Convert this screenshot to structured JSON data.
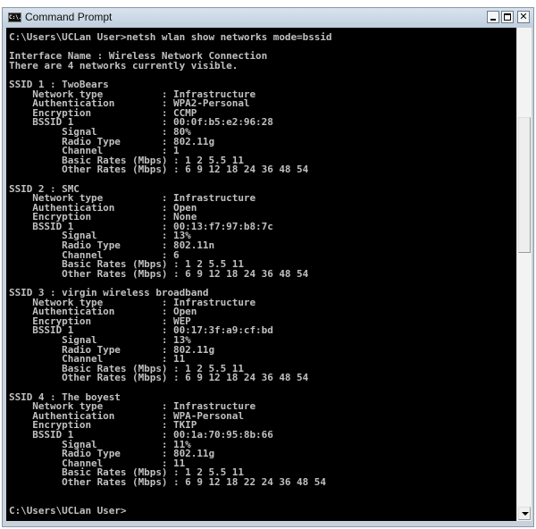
{
  "window": {
    "title": "Command Prompt",
    "icon": "cmd-icon",
    "icon_text": "C:\\.",
    "buttons": {
      "minimize": "minimize-icon",
      "maximize": "maximize-icon",
      "close": "✕"
    }
  },
  "console": {
    "command_prompt": "C:\\Users\\UCLan User>",
    "command": "netsh wlan show networks mode=bssid",
    "interface_line": "Interface Name : Wireless Network Connection",
    "summary_line": "There are 4 networks currently visible.",
    "networks": [
      {
        "ssid_index": "1",
        "ssid": "TwoBears",
        "network_type": "Infrastructure",
        "authentication": "WPA2-Personal",
        "encryption": "CCMP",
        "bssid_index": "1",
        "bssid": "00:0f:b5:e2:96:28",
        "signal": "80%",
        "radio_type": "802.11g",
        "channel": "1",
        "basic_rates": "1 2 5.5 11",
        "other_rates": "6 9 12 18 24 36 48 54"
      },
      {
        "ssid_index": "2",
        "ssid": "SMC",
        "network_type": "Infrastructure",
        "authentication": "Open",
        "encryption": "None",
        "bssid_index": "1",
        "bssid": "00:13:f7:97:b8:7c",
        "signal": "13%",
        "radio_type": "802.11n",
        "channel": "6",
        "basic_rates": "1 2 5.5 11",
        "other_rates": "6 9 12 18 24 36 48 54"
      },
      {
        "ssid_index": "3",
        "ssid": "virgin wireless broadband",
        "network_type": "Infrastructure",
        "authentication": "Open",
        "encryption": "WEP",
        "bssid_index": "1",
        "bssid": "00:17:3f:a9:cf:bd",
        "signal": "13%",
        "radio_type": "802.11g",
        "channel": "11",
        "basic_rates": "1 2 5.5 11",
        "other_rates": "6 9 12 18 24 36 48 54"
      },
      {
        "ssid_index": "4",
        "ssid": "The boyest",
        "network_type": "Infrastructure",
        "authentication": "WPA-Personal",
        "encryption": "TKIP",
        "bssid_index": "1",
        "bssid": "00:1a:70:95:8b:66",
        "signal": "11%",
        "radio_type": "802.11g",
        "channel": "11",
        "basic_rates": "1 2 5.5 11",
        "other_rates": "6 9 12 18 22 24 36 48 54"
      }
    ],
    "labels": {
      "network_type": "Network type",
      "authentication": "Authentication",
      "encryption": "Encryption",
      "bssid": "BSSID",
      "signal": "Signal",
      "radio_type": "Radio Type",
      "channel": "Channel",
      "basic_rates": "Basic Rates (Mbps)",
      "other_rates": "Other Rates (Mbps)",
      "ssid": "SSID"
    },
    "final_prompt": "C:\\Users\\UCLan User>"
  },
  "scrollbar": {
    "position_fraction": 0.18,
    "visible_fraction": 0.28
  },
  "colors": {
    "console_bg": "#000000",
    "console_fg": "#c0c0c0"
  }
}
